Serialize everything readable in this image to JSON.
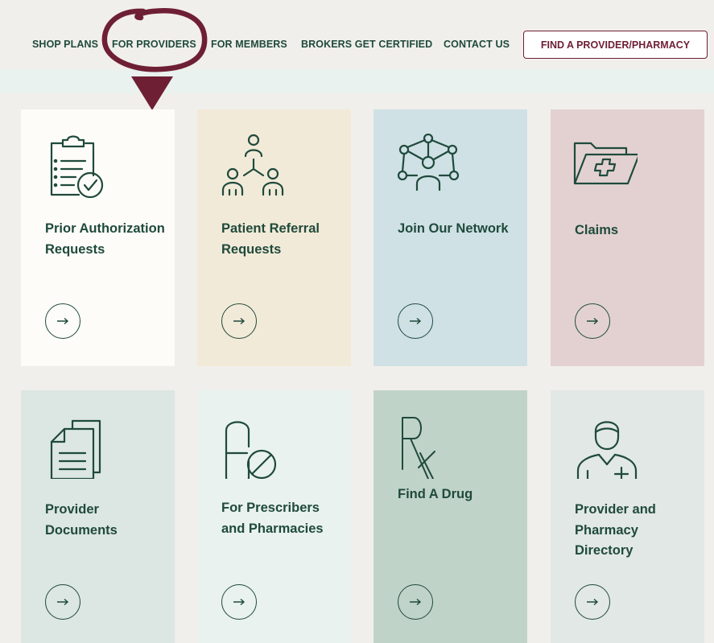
{
  "nav": {
    "items": [
      "SHOP PLANS",
      "FOR PROVIDERS",
      "FOR MEMBERS",
      "BROKERS GET CERTIFIED",
      "CONTACT US"
    ],
    "cta_label": "FIND A PROVIDER/PHARMACY"
  },
  "colors": {
    "accent": "#6e1f34",
    "text": "#1f4a3c",
    "page_bg": "#f1efeb"
  },
  "cards": [
    {
      "title": "Prior Authorization Requests",
      "icon": "clipboard-check-icon",
      "bg": "#fdfcf9"
    },
    {
      "title": "Patient Referral Requests",
      "icon": "people-network-icon",
      "bg": "#f2ead8"
    },
    {
      "title": "Join Our Network",
      "icon": "network-hub-icon",
      "bg": "#cfe1e5"
    },
    {
      "title": "Claims",
      "icon": "medical-folder-icon",
      "bg": "#e3d1d1"
    },
    {
      "title": "Provider Documents",
      "icon": "documents-icon",
      "bg": "#dce6e3"
    },
    {
      "title": "For Prescribers and Pharmacies",
      "icon": "pill-no-icon",
      "bg": "#e9f2ee"
    },
    {
      "title": "Find A Drug",
      "icon": "rx-icon",
      "bg": "#c0d3c9"
    },
    {
      "title": "Provider and Pharmacy Directory",
      "icon": "doctor-icon",
      "bg": "#e2e8e6"
    }
  ]
}
